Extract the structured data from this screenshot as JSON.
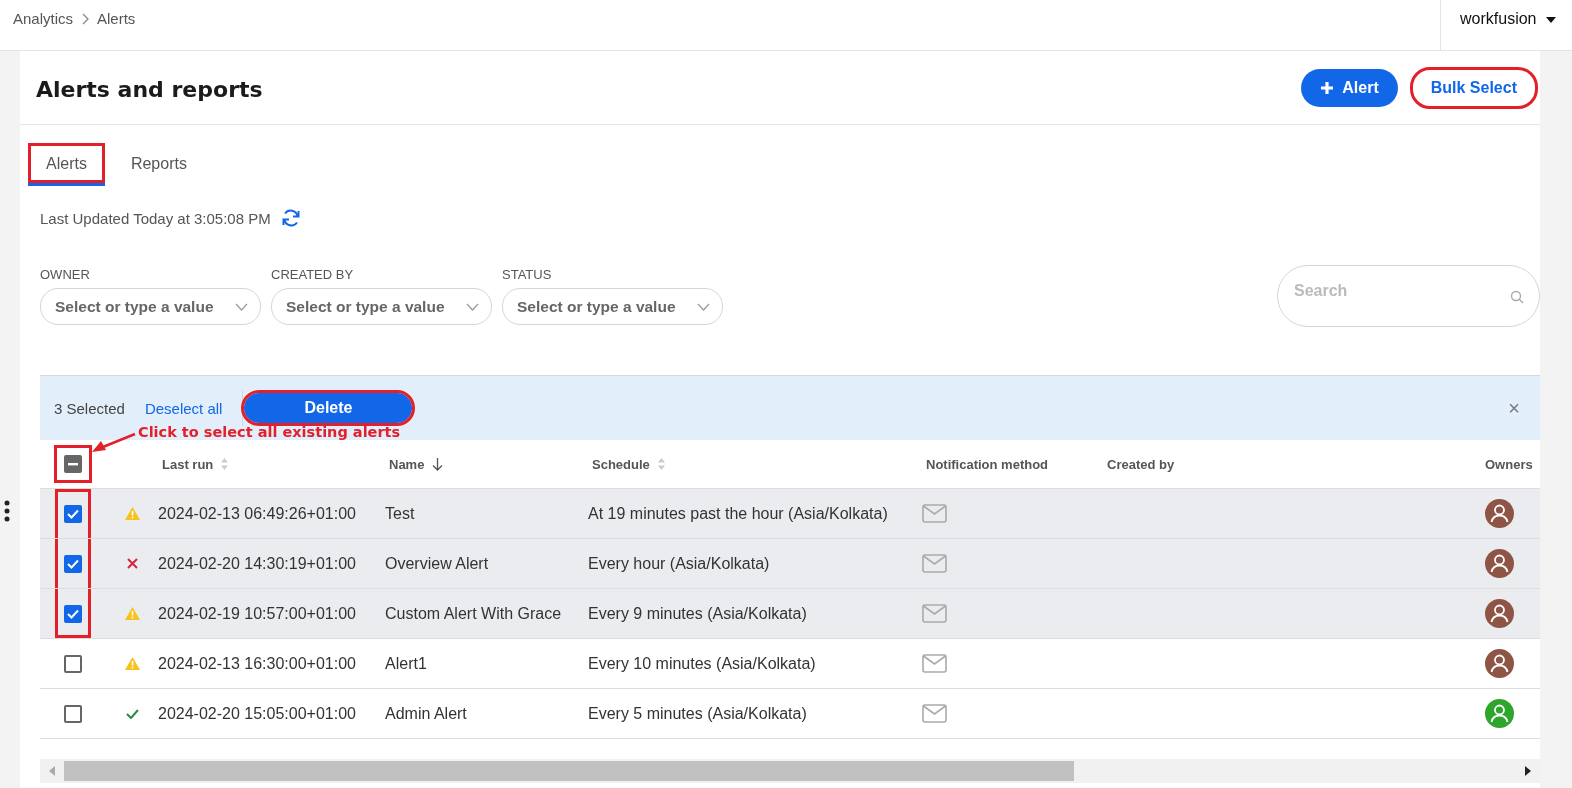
{
  "breadcrumb": [
    "Analytics",
    "Alerts"
  ],
  "user_menu": {
    "label": "workfusion"
  },
  "page": {
    "title": "Alerts and reports"
  },
  "actions": [
    {
      "kind": "primary",
      "label": "Alert",
      "highlighted": false
    },
    {
      "kind": "outline",
      "label": "Bulk Select",
      "highlighted": true
    }
  ],
  "tabs": [
    {
      "label": "Alerts",
      "selected": true,
      "highlighted": true
    },
    {
      "label": "Reports",
      "selected": false,
      "highlighted": false
    }
  ],
  "last_updated": "Last Updated Today at 3:05:08 PM",
  "filters": [
    {
      "label": "OWNER",
      "placeholder": "Select or type a value"
    },
    {
      "label": "CREATED BY",
      "placeholder": "Select or type a value"
    },
    {
      "label": "STATUS",
      "placeholder": "Select or type a value"
    }
  ],
  "search": {
    "placeholder": "Search"
  },
  "bulk_bar": {
    "count": "3 Selected",
    "deselect": "Deselect all",
    "delete": {
      "label": "Delete",
      "highlighted": true
    },
    "close": "×"
  },
  "callout": "Click to select all existing alerts",
  "table": {
    "header_checkbox": {
      "kind": "partial",
      "highlighted": true
    },
    "columns": [
      {
        "label": "Last run",
        "kind": "sortable"
      },
      {
        "label": "Name",
        "kind": "sorted"
      },
      {
        "label": "Schedule",
        "kind": "sortable"
      },
      {
        "label": "Notification method",
        "kind": "plain"
      },
      {
        "label": "Created by",
        "kind": "plain"
      },
      {
        "label": "Owners",
        "kind": "plain"
      }
    ],
    "rows": [
      {
        "checked": true,
        "highlighted": true,
        "kind": "warning",
        "last_run": "2024-02-13 06:49:26+01:00",
        "name": "Test",
        "schedule": "At 19 minutes past the hour (Asia/Kolkata)",
        "color": "#8e5446"
      },
      {
        "checked": true,
        "highlighted": true,
        "kind": "error",
        "last_run": "2024-02-20 14:30:19+01:00",
        "name": "Overview Alert",
        "schedule": "Every hour (Asia/Kolkata)",
        "color": "#8e5446"
      },
      {
        "checked": true,
        "highlighted": true,
        "kind": "warning",
        "last_run": "2024-02-19 10:57:00+01:00",
        "name": "Custom Alert With Grace",
        "schedule": "Every 9 minutes (Asia/Kolkata)",
        "color": "#8e5446"
      },
      {
        "checked": false,
        "highlighted": false,
        "kind": "warning",
        "last_run": "2024-02-13 16:30:00+01:00",
        "name": "Alert1",
        "schedule": "Every 10 minutes (Asia/Kolkata)",
        "color": "#8e5446"
      },
      {
        "checked": false,
        "highlighted": false,
        "kind": "success",
        "last_run": "2024-02-20 15:05:00+01:00",
        "name": "Admin Alert",
        "schedule": "Every 5 minutes (Asia/Kolkata)",
        "color": "#2ea52b"
      }
    ]
  }
}
